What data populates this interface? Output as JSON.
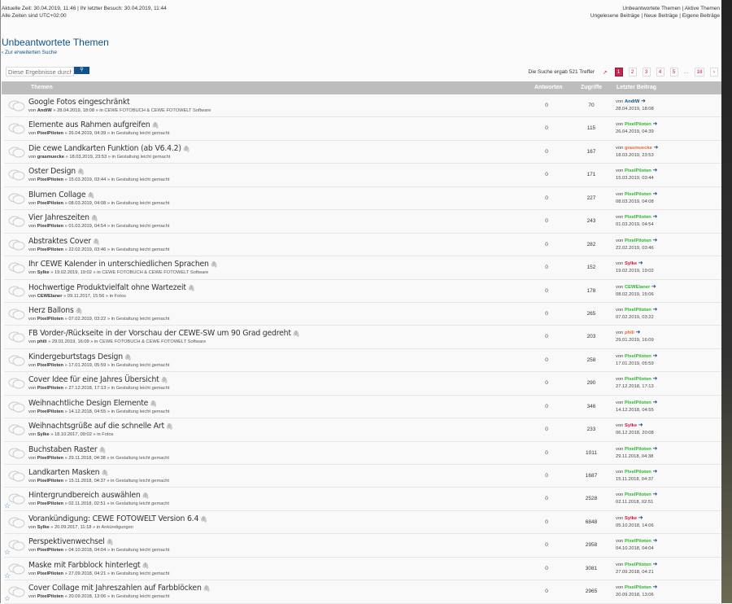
{
  "header": {
    "current_time": "Aktuelle Zeit: 30.04.2019, 11:46 | Ihr letzter Besuch: 30.04.2019, 11:44",
    "timezone": "Alle Zeiten sind UTC+02:00",
    "links_line1": [
      "Unbeantwortete Themen",
      "Aktive Themen"
    ],
    "links_line2": [
      "Ungelesene Beiträge",
      "Neue Beiträge",
      "Eigene Beiträge"
    ]
  },
  "page_title": "Unbeantwortete Themen",
  "back_link": "Zur erweiterten Suche",
  "search": {
    "placeholder": "Diese Ergebnisse durchsuchen",
    "button": "search-icon"
  },
  "pagination": {
    "results": "Die Suche ergab 521 Treffer",
    "pages": [
      "1",
      "2",
      "3",
      "4",
      "5",
      "…",
      "18"
    ],
    "current": "1",
    "next": "next-icon"
  },
  "columns": {
    "topics": "Themen",
    "replies": "Antworten",
    "views": "Zugriffe",
    "last_post": "Letzter Beitrag"
  },
  "colors": {
    "accent": "#105289",
    "PixelPiloten": "#2bb52b",
    "CEWElaner": "#2bb52b",
    "AndiW": "#105289",
    "grasmuecke": "#e86a3a",
    "phili": "#e86a3a",
    "Sylke": "#d31141"
  },
  "rows": [
    {
      "title": "Google Fotos eingeschränkt",
      "attach": false,
      "star": false,
      "author": "AndiW",
      "date": "28.04.2019, 18:08",
      "forum": "CEWE FOTOBUCH & CEWE FOTOWELT Software",
      "replies": "0",
      "views": "70",
      "last_author": "AndiW",
      "last_date": "28.04.2019, 18:08"
    },
    {
      "title": "Elemente aus Rahmen aufgreifen",
      "attach": true,
      "star": false,
      "author": "PixelPiloten",
      "date": "26.04.2019, 04:39",
      "forum": "Gestaltung leicht gemacht",
      "replies": "0",
      "views": "115",
      "last_author": "PixelPiloten",
      "last_date": "26.04.2019, 04:39"
    },
    {
      "title": "Die cewe Landkarten Funktion (ab V6.4.2)",
      "attach": true,
      "star": false,
      "author": "grasmuecke",
      "date": "18.03.2019, 23:53",
      "forum": "Gestaltung leicht gemacht",
      "replies": "0",
      "views": "167",
      "last_author": "grasmuecke",
      "last_date": "18.03.2019, 23:53"
    },
    {
      "title": "Oster Design",
      "attach": true,
      "star": false,
      "author": "PixelPiloten",
      "date": "15.03.2019, 03:44",
      "forum": "Gestaltung leicht gemacht",
      "replies": "0",
      "views": "171",
      "last_author": "PixelPiloten",
      "last_date": "15.03.2019, 03:44"
    },
    {
      "title": "Blumen Collage",
      "attach": true,
      "star": false,
      "author": "PixelPiloten",
      "date": "08.03.2019, 04:08",
      "forum": "Gestaltung leicht gemacht",
      "replies": "0",
      "views": "227",
      "last_author": "PixelPiloten",
      "last_date": "08.03.2019, 04:08"
    },
    {
      "title": "Vier Jahreszeiten",
      "attach": true,
      "star": false,
      "author": "PixelPiloten",
      "date": "01.03.2019, 04:54",
      "forum": "Gestaltung leicht gemacht",
      "replies": "0",
      "views": "243",
      "last_author": "PixelPiloten",
      "last_date": "01.03.2019, 04:54"
    },
    {
      "title": "Abstraktes Cover",
      "attach": true,
      "star": false,
      "author": "PixelPiloten",
      "date": "22.02.2019, 03:46",
      "forum": "Gestaltung leicht gemacht",
      "replies": "0",
      "views": "282",
      "last_author": "PixelPiloten",
      "last_date": "22.02.2019, 03:46"
    },
    {
      "title": "Ihr CEWE Kalender in unterschiedlichen Sprachen",
      "attach": true,
      "star": false,
      "author": "Sylke",
      "date": "19.02.2019, 19:02",
      "forum": "CEWE FOTOBUCH & CEWE FOTOWELT Software",
      "replies": "0",
      "views": "152",
      "last_author": "Sylke",
      "last_date": "19.02.2019, 19:02"
    },
    {
      "title": "Hochwertige Produktvielfalt ohne Wartezeit",
      "attach": true,
      "star": false,
      "author": "CEWElaner",
      "date": "09.11.2017, 15:56",
      "forum": "Fotos",
      "replies": "0",
      "views": "178",
      "last_author": "CEWElaner",
      "last_date": "08.02.2019, 15:06"
    },
    {
      "title": "Herz Ballons",
      "attach": true,
      "star": false,
      "author": "PixelPiloten",
      "date": "07.02.2019, 03:22",
      "forum": "Gestaltung leicht gemacht",
      "replies": "0",
      "views": "265",
      "last_author": "PixelPiloten",
      "last_date": "07.02.2019, 03:22"
    },
    {
      "title": "FB Vorder-/Rückseite in der Vorschau der CEWE-SW um 90 Grad gedreht",
      "attach": true,
      "star": false,
      "author": "phili",
      "date": "29.01.2019, 16:09",
      "forum": "CEWE FOTOBUCH & CEWE FOTOWELT Software",
      "replies": "0",
      "views": "203",
      "last_author": "phili",
      "last_date": "29.01.2019, 16:09"
    },
    {
      "title": "Kindergeburtstags Design",
      "attach": true,
      "star": false,
      "author": "PixelPiloten",
      "date": "17.01.2019, 05:59",
      "forum": "Gestaltung leicht gemacht",
      "replies": "0",
      "views": "258",
      "last_author": "PixelPiloten",
      "last_date": "17.01.2019, 05:59"
    },
    {
      "title": "Cover Idee für eine Jahres Übersicht",
      "attach": true,
      "star": false,
      "author": "PixelPiloten",
      "date": "27.12.2018, 17:13",
      "forum": "Gestaltung leicht gemacht",
      "replies": "0",
      "views": "290",
      "last_author": "PixelPiloten",
      "last_date": "27.12.2018, 17:13"
    },
    {
      "title": "Weihnachtliche Design Elemente",
      "attach": true,
      "star": false,
      "author": "PixelPiloten",
      "date": "14.12.2018, 04:55",
      "forum": "Gestaltung leicht gemacht",
      "replies": "0",
      "views": "346",
      "last_author": "PixelPiloten",
      "last_date": "14.12.2018, 04:55"
    },
    {
      "title": "Weihnachtsgrüße auf die schnelle Art",
      "attach": true,
      "star": false,
      "author": "Sylke",
      "date": "18.10.2017, 09:02",
      "forum": "Fotos",
      "replies": "0",
      "views": "233",
      "last_author": "Sylke",
      "last_date": "06.12.2018, 20:08"
    },
    {
      "title": "Buchstaben Raster",
      "attach": true,
      "star": false,
      "author": "PixelPiloten",
      "date": "29.11.2018, 04:38",
      "forum": "Gestaltung leicht gemacht",
      "replies": "0",
      "views": "1011",
      "last_author": "PixelPiloten",
      "last_date": "29.11.2018, 04:38"
    },
    {
      "title": "Landkarten Masken",
      "attach": true,
      "star": false,
      "author": "PixelPiloten",
      "date": "15.11.2018, 04:37",
      "forum": "Gestaltung leicht gemacht",
      "replies": "0",
      "views": "1687",
      "last_author": "PixelPiloten",
      "last_date": "15.11.2018, 04:37"
    },
    {
      "title": "Hintergrundbereich auswählen",
      "attach": true,
      "star": true,
      "author": "PixelPiloten",
      "date": "02.11.2018, 02:51",
      "forum": "Gestaltung leicht gemacht",
      "replies": "0",
      "views": "2528",
      "last_author": "PixelPiloten",
      "last_date": "02.11.2018, 02:51"
    },
    {
      "title": "Vorankündigung: CEWE FOTOWELT Version 6.4",
      "attach": true,
      "star": false,
      "author": "Sylke",
      "date": "20.09.2017, 11:18",
      "forum": "Ankündigungen",
      "replies": "0",
      "views": "6848",
      "last_author": "Sylke",
      "last_date": "05.10.2018, 14:06"
    },
    {
      "title": "Perspektivenwechsel",
      "attach": true,
      "star": true,
      "author": "PixelPiloten",
      "date": "04.10.2018, 04:04",
      "forum": "Gestaltung leicht gemacht",
      "replies": "0",
      "views": "2958",
      "last_author": "PixelPiloten",
      "last_date": "04.10.2018, 04:04"
    },
    {
      "title": "Maske mit Farbblock hinterlegt",
      "attach": true,
      "star": true,
      "author": "PixelPiloten",
      "date": "27.09.2018, 04:21",
      "forum": "Gestaltung leicht gemacht",
      "replies": "0",
      "views": "3081",
      "last_author": "PixelPiloten",
      "last_date": "27.09.2018, 04:21"
    },
    {
      "title": "Cover Collage mit Jahreszahlen auf Farbblöcken",
      "attach": true,
      "star": true,
      "author": "PixelPiloten",
      "date": "20.09.2018, 13:06",
      "forum": "Gestaltung leicht gemacht",
      "replies": "0",
      "views": "2965",
      "last_author": "PixelPiloten",
      "last_date": "20.09.2018, 13:06"
    }
  ],
  "labels": {
    "by": "von",
    "sep": "»",
    "in": "in"
  }
}
